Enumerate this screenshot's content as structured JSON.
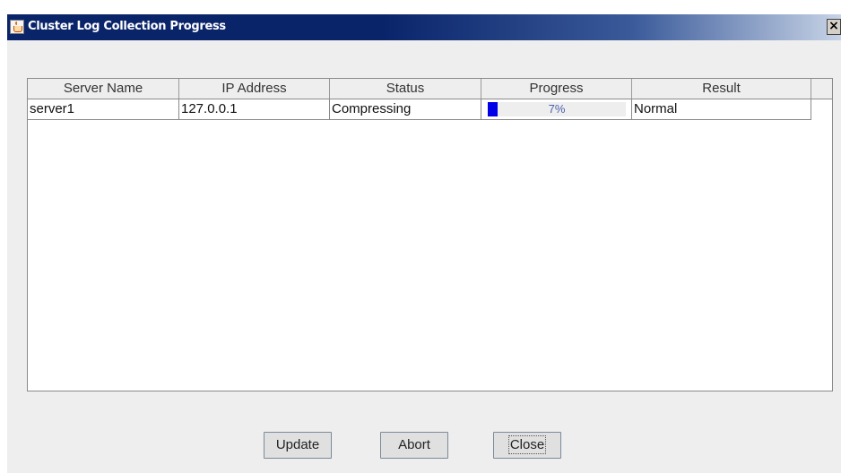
{
  "window": {
    "title": "Cluster Log Collection Progress",
    "app_icon": "java-cup-icon",
    "close_label": "×"
  },
  "table": {
    "columns": [
      "Server Name",
      "IP Address",
      "Status",
      "Progress",
      "Result"
    ],
    "rows": [
      {
        "server_name": "server1",
        "ip_address": "127.0.0.1",
        "status": "Compressing",
        "progress": {
          "value": 7,
          "label": "7%"
        },
        "result": "Normal"
      }
    ]
  },
  "buttons": {
    "update": "Update",
    "abort": "Abort",
    "close": "Close"
  },
  "colors": {
    "titlebar": "#0a246a",
    "progress_fill": "#0000e8",
    "progress_text": "#4a60b0",
    "dialog_background": "#eeeeee"
  }
}
